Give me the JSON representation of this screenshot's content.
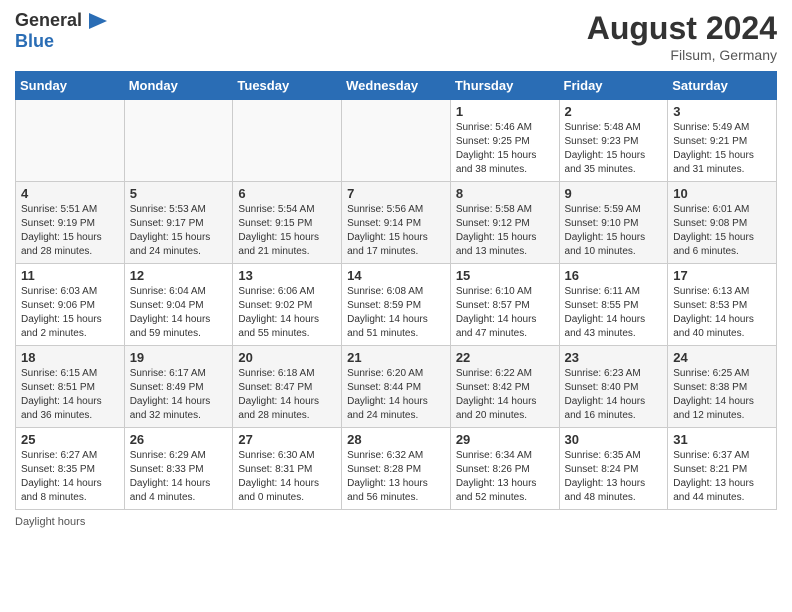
{
  "header": {
    "logo_general": "General",
    "logo_blue": "Blue",
    "month_year": "August 2024",
    "location": "Filsum, Germany"
  },
  "days_of_week": [
    "Sunday",
    "Monday",
    "Tuesday",
    "Wednesday",
    "Thursday",
    "Friday",
    "Saturday"
  ],
  "footer_text": "Daylight hours",
  "weeks": [
    [
      {
        "day": "",
        "info": ""
      },
      {
        "day": "",
        "info": ""
      },
      {
        "day": "",
        "info": ""
      },
      {
        "day": "",
        "info": ""
      },
      {
        "day": "1",
        "info": "Sunrise: 5:46 AM\nSunset: 9:25 PM\nDaylight: 15 hours\nand 38 minutes."
      },
      {
        "day": "2",
        "info": "Sunrise: 5:48 AM\nSunset: 9:23 PM\nDaylight: 15 hours\nand 35 minutes."
      },
      {
        "day": "3",
        "info": "Sunrise: 5:49 AM\nSunset: 9:21 PM\nDaylight: 15 hours\nand 31 minutes."
      }
    ],
    [
      {
        "day": "4",
        "info": "Sunrise: 5:51 AM\nSunset: 9:19 PM\nDaylight: 15 hours\nand 28 minutes."
      },
      {
        "day": "5",
        "info": "Sunrise: 5:53 AM\nSunset: 9:17 PM\nDaylight: 15 hours\nand 24 minutes."
      },
      {
        "day": "6",
        "info": "Sunrise: 5:54 AM\nSunset: 9:15 PM\nDaylight: 15 hours\nand 21 minutes."
      },
      {
        "day": "7",
        "info": "Sunrise: 5:56 AM\nSunset: 9:14 PM\nDaylight: 15 hours\nand 17 minutes."
      },
      {
        "day": "8",
        "info": "Sunrise: 5:58 AM\nSunset: 9:12 PM\nDaylight: 15 hours\nand 13 minutes."
      },
      {
        "day": "9",
        "info": "Sunrise: 5:59 AM\nSunset: 9:10 PM\nDaylight: 15 hours\nand 10 minutes."
      },
      {
        "day": "10",
        "info": "Sunrise: 6:01 AM\nSunset: 9:08 PM\nDaylight: 15 hours\nand 6 minutes."
      }
    ],
    [
      {
        "day": "11",
        "info": "Sunrise: 6:03 AM\nSunset: 9:06 PM\nDaylight: 15 hours\nand 2 minutes."
      },
      {
        "day": "12",
        "info": "Sunrise: 6:04 AM\nSunset: 9:04 PM\nDaylight: 14 hours\nand 59 minutes."
      },
      {
        "day": "13",
        "info": "Sunrise: 6:06 AM\nSunset: 9:02 PM\nDaylight: 14 hours\nand 55 minutes."
      },
      {
        "day": "14",
        "info": "Sunrise: 6:08 AM\nSunset: 8:59 PM\nDaylight: 14 hours\nand 51 minutes."
      },
      {
        "day": "15",
        "info": "Sunrise: 6:10 AM\nSunset: 8:57 PM\nDaylight: 14 hours\nand 47 minutes."
      },
      {
        "day": "16",
        "info": "Sunrise: 6:11 AM\nSunset: 8:55 PM\nDaylight: 14 hours\nand 43 minutes."
      },
      {
        "day": "17",
        "info": "Sunrise: 6:13 AM\nSunset: 8:53 PM\nDaylight: 14 hours\nand 40 minutes."
      }
    ],
    [
      {
        "day": "18",
        "info": "Sunrise: 6:15 AM\nSunset: 8:51 PM\nDaylight: 14 hours\nand 36 minutes."
      },
      {
        "day": "19",
        "info": "Sunrise: 6:17 AM\nSunset: 8:49 PM\nDaylight: 14 hours\nand 32 minutes."
      },
      {
        "day": "20",
        "info": "Sunrise: 6:18 AM\nSunset: 8:47 PM\nDaylight: 14 hours\nand 28 minutes."
      },
      {
        "day": "21",
        "info": "Sunrise: 6:20 AM\nSunset: 8:44 PM\nDaylight: 14 hours\nand 24 minutes."
      },
      {
        "day": "22",
        "info": "Sunrise: 6:22 AM\nSunset: 8:42 PM\nDaylight: 14 hours\nand 20 minutes."
      },
      {
        "day": "23",
        "info": "Sunrise: 6:23 AM\nSunset: 8:40 PM\nDaylight: 14 hours\nand 16 minutes."
      },
      {
        "day": "24",
        "info": "Sunrise: 6:25 AM\nSunset: 8:38 PM\nDaylight: 14 hours\nand 12 minutes."
      }
    ],
    [
      {
        "day": "25",
        "info": "Sunrise: 6:27 AM\nSunset: 8:35 PM\nDaylight: 14 hours\nand 8 minutes."
      },
      {
        "day": "26",
        "info": "Sunrise: 6:29 AM\nSunset: 8:33 PM\nDaylight: 14 hours\nand 4 minutes."
      },
      {
        "day": "27",
        "info": "Sunrise: 6:30 AM\nSunset: 8:31 PM\nDaylight: 14 hours\nand 0 minutes."
      },
      {
        "day": "28",
        "info": "Sunrise: 6:32 AM\nSunset: 8:28 PM\nDaylight: 13 hours\nand 56 minutes."
      },
      {
        "day": "29",
        "info": "Sunrise: 6:34 AM\nSunset: 8:26 PM\nDaylight: 13 hours\nand 52 minutes."
      },
      {
        "day": "30",
        "info": "Sunrise: 6:35 AM\nSunset: 8:24 PM\nDaylight: 13 hours\nand 48 minutes."
      },
      {
        "day": "31",
        "info": "Sunrise: 6:37 AM\nSunset: 8:21 PM\nDaylight: 13 hours\nand 44 minutes."
      }
    ]
  ]
}
